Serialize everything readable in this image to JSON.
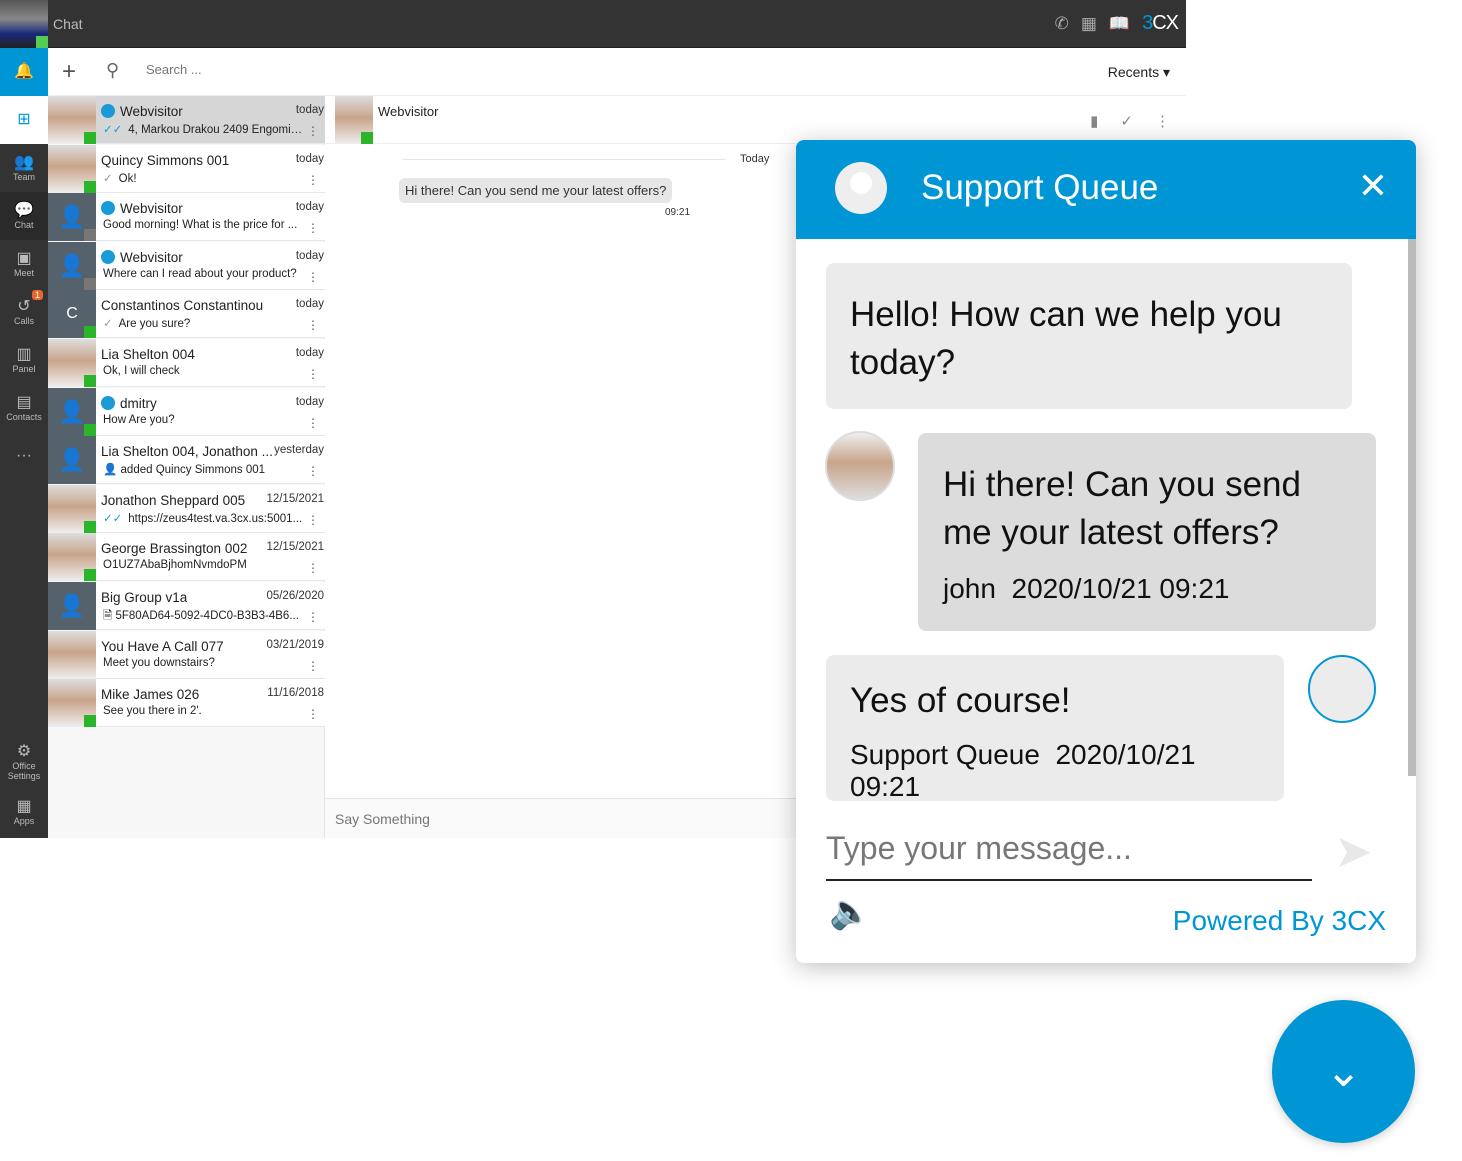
{
  "app": {
    "title": "Chat",
    "logo": "3CX",
    "header_icons": [
      "phone-icon",
      "qr-code-icon",
      "book-icon"
    ]
  },
  "nav": {
    "items": [
      {
        "label": "",
        "icon": "bell-icon"
      },
      {
        "label": "",
        "icon": "windows-icon"
      },
      {
        "label": "Team",
        "icon": "team-icon"
      },
      {
        "label": "Chat",
        "icon": "chat-icon"
      },
      {
        "label": "Meet",
        "icon": "meet-icon"
      },
      {
        "label": "Calls",
        "icon": "calls-icon",
        "badge": "1"
      },
      {
        "label": "Panel",
        "icon": "panel-icon"
      },
      {
        "label": "Contacts",
        "icon": "contacts-icon"
      },
      {
        "label": "",
        "icon": "more-icon"
      }
    ],
    "bottom": [
      {
        "label": "Office Settings",
        "icon": "gear-icon"
      },
      {
        "label": "Apps",
        "icon": "apps-icon"
      }
    ]
  },
  "toolbar": {
    "search_placeholder": "Search ...",
    "recents": "Recents"
  },
  "conversations": [
    {
      "name": "Webvisitor",
      "date": "today",
      "msg": "4, Markou Drakou 2409 Engomi ...",
      "webvisitor": true,
      "check": "double",
      "photo": true,
      "status": "online",
      "selected": true
    },
    {
      "name": "Quincy Simmons 001",
      "date": "today",
      "msg": "Ok!",
      "check": "single",
      "photo": true,
      "status": "online"
    },
    {
      "name": "Webvisitor",
      "date": "today",
      "msg": "Good morning! What is the price for ...",
      "webvisitor": true,
      "status": "offline"
    },
    {
      "name": "Webvisitor",
      "date": "today",
      "msg": "Where can I read about your product?",
      "webvisitor": true,
      "status": "offline"
    },
    {
      "name": "Constantinos Constantinou",
      "date": "today",
      "msg": "Are you sure?",
      "check": "single",
      "initial": "C",
      "status": "online"
    },
    {
      "name": "Lia Shelton 004",
      "date": "today",
      "msg": "Ok, I will check",
      "photo": true,
      "status": "online"
    },
    {
      "name": "dmitry",
      "date": "today",
      "msg": "How Are you?",
      "webvisitor": true,
      "status": "online"
    },
    {
      "name": "Lia Shelton 004, Jonathon ...",
      "date": "yesterday",
      "msg": "added Quincy Simmons 001",
      "prefix": "👤"
    },
    {
      "name": "Jonathon Sheppard 005",
      "date": "12/15/2021",
      "msg": "https://zeus4test.va.3cx.us:5001...",
      "check": "double",
      "photo": true,
      "status": "online"
    },
    {
      "name": "George Brassington 002",
      "date": "12/15/2021",
      "msg": "O1UZ7AbaBjhomNvmdoPM",
      "photo": true,
      "status": "online"
    },
    {
      "name": "Big Group v1a",
      "date": "05/26/2020",
      "msg": "5F80AD64-5092-4DC0-B3B3-4B6...",
      "prefix": "🗎"
    },
    {
      "name": "You Have A Call 077",
      "date": "03/21/2019",
      "msg": "Meet you downstairs?",
      "photo": true
    },
    {
      "name": "Mike James 026",
      "date": "11/16/2018",
      "msg": "See you there in 2'.",
      "photo": true,
      "status": "online"
    }
  ],
  "chat": {
    "name": "Webvisitor",
    "day": "Today",
    "message": "Hi there! Can you send me your latest offers?",
    "time": "09:21",
    "input_placeholder": "Say Something"
  },
  "widget": {
    "title": "Support Queue",
    "messages": [
      {
        "text": "Hello! How can we help you today?"
      },
      {
        "text": "Hi there! Can you send me your latest offers?",
        "author": "john",
        "time": "2020/10/21 09:21"
      },
      {
        "text": "Yes of course!",
        "author": "Support Queue",
        "time": "2020/10/21 09:21"
      }
    ],
    "input_placeholder": "Type your message...",
    "powered": "Powered By 3CX"
  },
  "colors": {
    "accent": "#0096d6",
    "online": "#2bb52b",
    "dark": "#333333",
    "badge": "#e8662b"
  }
}
